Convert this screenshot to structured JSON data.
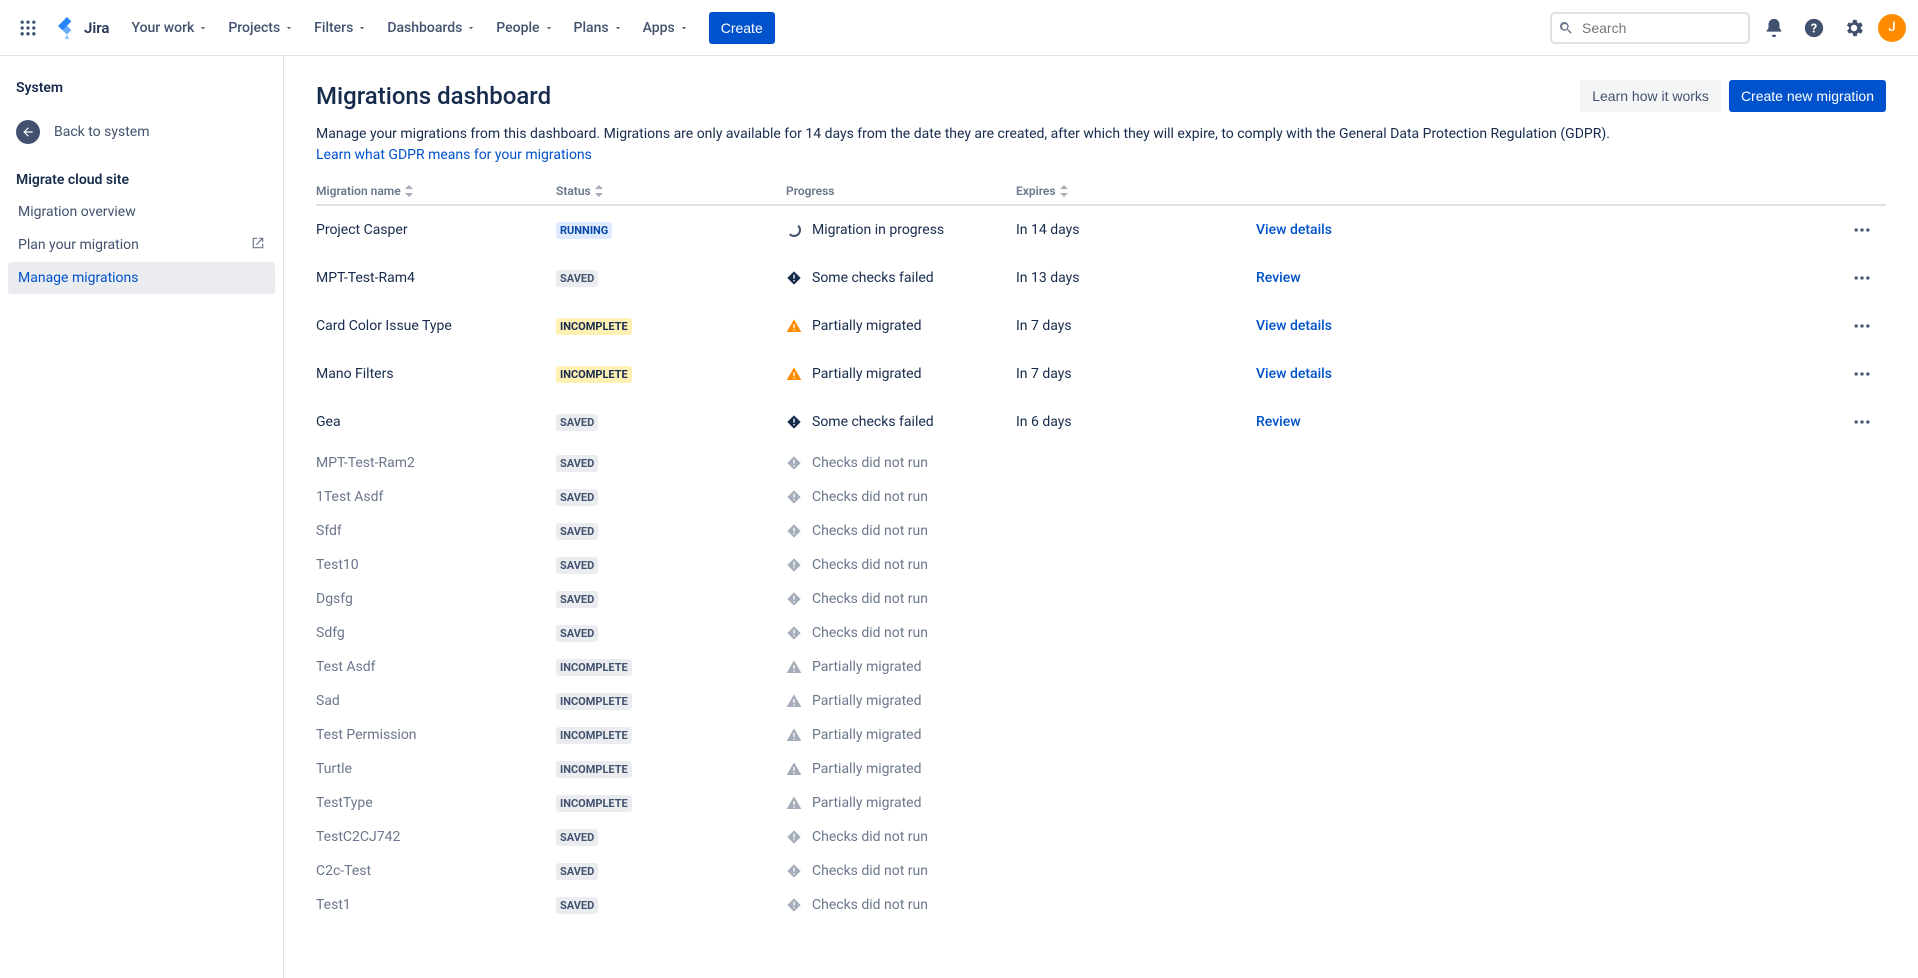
{
  "nav": {
    "logo_text": "Jira",
    "items": [
      "Your work",
      "Projects",
      "Filters",
      "Dashboards",
      "People",
      "Plans",
      "Apps"
    ],
    "create_label": "Create",
    "search_placeholder": "Search",
    "avatar_initial": "J"
  },
  "sidebar": {
    "section": "System",
    "back_label": "Back to system",
    "group": "Migrate cloud site",
    "items": [
      {
        "label": "Migration overview",
        "external": false,
        "active": false
      },
      {
        "label": "Plan your migration",
        "external": true,
        "active": false
      },
      {
        "label": "Manage migrations",
        "external": false,
        "active": true
      }
    ]
  },
  "page": {
    "title": "Migrations dashboard",
    "learn_btn": "Learn how it works",
    "create_btn": "Create new migration",
    "description": "Manage your migrations from this dashboard. Migrations are only available for 14 days from the date they are created, after which they will expire, to comply with the General Data Protection Regulation (GDPR).",
    "gdpr_link": "Learn what GDPR means for your migrations"
  },
  "table": {
    "headers": {
      "name": "Migration name",
      "status": "Status",
      "progress": "Progress",
      "expires": "Expires"
    },
    "status_labels": {
      "RUNNING": "RUNNING",
      "SAVED": "SAVED",
      "INCOMPLETE": "INCOMPLETE"
    },
    "action_labels": {
      "view": "View details",
      "review": "Review"
    },
    "rows": [
      {
        "name": "Project Casper",
        "status": "RUNNING",
        "progress_icon": "spinner",
        "progress_text": "Migration in progress",
        "expires": "In 14 days",
        "action": "view",
        "active": true
      },
      {
        "name": "MPT-Test-Ram4",
        "status": "SAVED",
        "progress_icon": "error-dark",
        "progress_text": "Some checks failed",
        "expires": "In 13 days",
        "action": "review",
        "active": true
      },
      {
        "name": "Card Color Issue Type",
        "status": "INCOMPLETE",
        "progress_icon": "warn-orange",
        "progress_text": "Partially migrated",
        "expires": "In 7 days",
        "action": "view",
        "active": true
      },
      {
        "name": "Mano Filters",
        "status": "INCOMPLETE",
        "progress_icon": "warn-orange",
        "progress_text": "Partially migrated",
        "expires": "In 7 days",
        "action": "view",
        "active": true
      },
      {
        "name": "Gea",
        "status": "SAVED",
        "progress_icon": "error-dark",
        "progress_text": "Some checks failed",
        "expires": "In 6 days",
        "action": "review",
        "active": true
      },
      {
        "name": "MPT-Test-Ram2",
        "status": "SAVED",
        "progress_icon": "info-gray",
        "progress_text": "Checks did not run",
        "expires": "",
        "action": "",
        "active": false
      },
      {
        "name": "1Test Asdf",
        "status": "SAVED",
        "progress_icon": "info-gray",
        "progress_text": "Checks did not run",
        "expires": "",
        "action": "",
        "active": false
      },
      {
        "name": "Sfdf",
        "status": "SAVED",
        "progress_icon": "info-gray",
        "progress_text": "Checks did not run",
        "expires": "",
        "action": "",
        "active": false
      },
      {
        "name": "Test10",
        "status": "SAVED",
        "progress_icon": "info-gray",
        "progress_text": "Checks did not run",
        "expires": "",
        "action": "",
        "active": false
      },
      {
        "name": "Dgsfg",
        "status": "SAVED",
        "progress_icon": "info-gray",
        "progress_text": "Checks did not run",
        "expires": "",
        "action": "",
        "active": false
      },
      {
        "name": "Sdfg",
        "status": "SAVED",
        "progress_icon": "info-gray",
        "progress_text": "Checks did not run",
        "expires": "",
        "action": "",
        "active": false
      },
      {
        "name": "Test Asdf",
        "status": "INCOMPLETE",
        "progress_icon": "warn-gray",
        "progress_text": "Partially migrated",
        "expires": "",
        "action": "",
        "active": false
      },
      {
        "name": "Sad",
        "status": "INCOMPLETE",
        "progress_icon": "warn-gray",
        "progress_text": "Partially migrated",
        "expires": "",
        "action": "",
        "active": false
      },
      {
        "name": "Test Permission",
        "status": "INCOMPLETE",
        "progress_icon": "warn-gray",
        "progress_text": "Partially migrated",
        "expires": "",
        "action": "",
        "active": false
      },
      {
        "name": "Turtle",
        "status": "INCOMPLETE",
        "progress_icon": "warn-gray",
        "progress_text": "Partially migrated",
        "expires": "",
        "action": "",
        "active": false
      },
      {
        "name": "TestType",
        "status": "INCOMPLETE",
        "progress_icon": "warn-gray",
        "progress_text": "Partially migrated",
        "expires": "",
        "action": "",
        "active": false
      },
      {
        "name": "TestC2CJ742",
        "status": "SAVED",
        "progress_icon": "info-gray",
        "progress_text": "Checks did not run",
        "expires": "",
        "action": "",
        "active": false
      },
      {
        "name": "C2c-Test",
        "status": "SAVED",
        "progress_icon": "info-gray",
        "progress_text": "Checks did not run",
        "expires": "",
        "action": "",
        "active": false
      },
      {
        "name": "Test1",
        "status": "SAVED",
        "progress_icon": "info-gray",
        "progress_text": "Checks did not run",
        "expires": "",
        "action": "",
        "active": false
      }
    ]
  }
}
